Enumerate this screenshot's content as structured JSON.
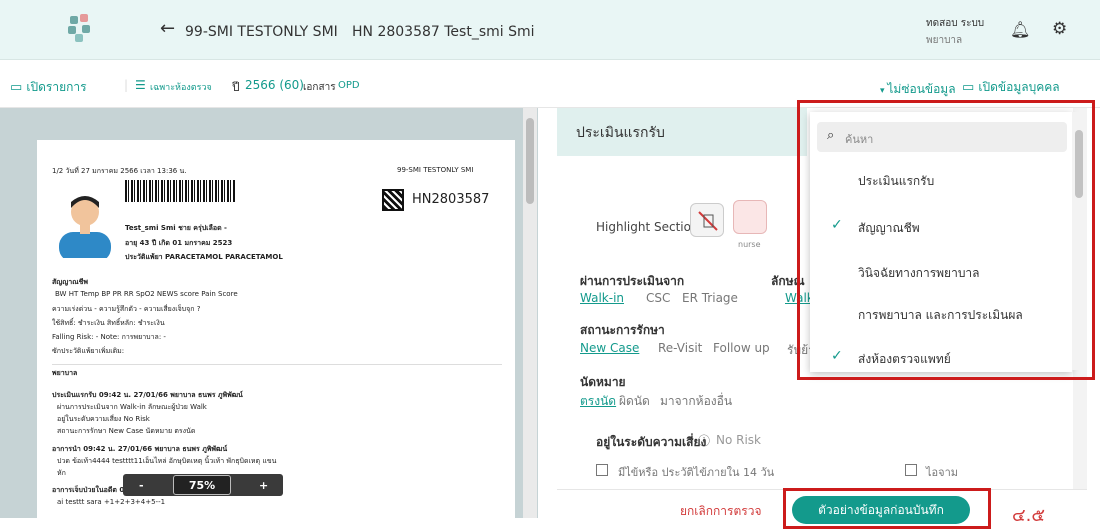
{
  "header": {
    "patient": "99-SMI TESTONLY SMI",
    "hn": "HN 2803587 Test_smi Smi",
    "user_name": "ทดสอบ ระบบ",
    "user_role": "พยาบาล"
  },
  "subbar": {
    "open_list": "เปิดรายการ",
    "filter": "เฉพาะห้องตรวจ",
    "year_label": "ปี",
    "year_value": "2566 (60)",
    "doc_label": "เอกสาร",
    "doc_value": "OPD",
    "hide_data": "ไม่ซ่อนข้อมูล",
    "open_personal": "เปิดข้อมูลบุคคล"
  },
  "doc": {
    "line1": "1/2  วันที่ 27 มกราคม 2566  เวลา 13:36 น.",
    "org": "99-SMI TESTONLY SMI",
    "hn": "HN2803587",
    "name": "Test_smi Smi  ชาย  ครุ่ปเลือด -",
    "age": "อายุ 43 ปี  เกิด 01 มกราคม 2523",
    "allergy": "ประวัติแพ้ยา PARACETAMOL PARACETAMOL",
    "vitals_title": "สัญญาณชีพ",
    "vitals_cols": "BW        HT        Temp      BP        PR        RR        SpO2      NEWS score Pain Score",
    "v1": "ความเร่งด่วน -  ความรู้สึกตัว -  ความเสี่ยงเจ็บจุก ?",
    "v2": "ใช้สิทธิ์: ชำระเงิน  สิทธิ์หลัก: ชำระเงิน",
    "v3": "Falling Risk:        -            Note:                    การพยาบาล: -",
    "v4": "ซักประวัติแพ้ยาเพิ่มเติม:",
    "nurse": "พยาบาล",
    "n1": "ประเมินแรกรับ 09:42 น. 27/01/66 พยาบาล ธนพร ภูพิพัฒน์",
    "n2": "ผ่านการประเมินจาก Walk-in  ลักษณะผู้ป่วย Walk",
    "n3": "อยู่ในระดับความเสี่ยง No Risk",
    "n4": "สถานะการรักษา New Case  นัดหมาย ตรงนัด",
    "n5": "อาการนำ 09:42 น. 27/01/66 พยาบาล ธนพร ภูพิพัฒน์",
    "n6": "ปวด ข้อเท้า4444 testttt11เอ็นไหล่ อักษุบิดเหตุ นิ้วเท้า พักธุบิดเหตุ แขน",
    "n7": "หัก",
    "n8": "อาการเจ็บป่วยในอดีต 09:42 น. 27/01/66 พยาบาล ธนพร ภูพิพัฒน์",
    "n9": "ai testtt sara +1+2+3+4+5--1"
  },
  "zoom": {
    "minus": "-",
    "pct": "75%",
    "plus": "+"
  },
  "form": {
    "title": "ประเมินแรกรับ",
    "highlight": "Highlight Section",
    "nurse_tag": "nurse",
    "assess_from": "ผ่านการประเมินจาก",
    "af_opts": [
      "Walk-in",
      "CSC",
      "ER Triage"
    ],
    "char_label": "ลักษณ",
    "char_sel": "Walk",
    "status": "สถานะการรักษา",
    "st_opts": [
      "New Case",
      "Re-Visit",
      "Follow up",
      "รับย้าย"
    ],
    "appt": "นัดหมาย",
    "appt_opts": [
      "ตรงนัด",
      "ผิดนัด",
      "มาจากห้องอื่น"
    ],
    "risk": "อยู่ในระดับความเสี่ยง",
    "risk_val": "No Risk",
    "chk1": "มีไข้หรือ ประวัติไข้ภายใน 14 วัน",
    "chk2": "ไอจาม"
  },
  "dropdown": {
    "search": "ค้นหา",
    "items": [
      "ประเมินแรกรับ",
      "สัญญาณชีพ",
      "วินิจฉัยทางการพยาบาล",
      "การพยาบาล และการประเมินผล",
      "ส่งห้องตรวจแพทย์"
    ]
  },
  "footer": {
    "cancel": "ยกเลิกการตรวจ",
    "save": "ตัวอย่างข้อมูลก่อนบันทึก",
    "version": "๔.๕"
  }
}
